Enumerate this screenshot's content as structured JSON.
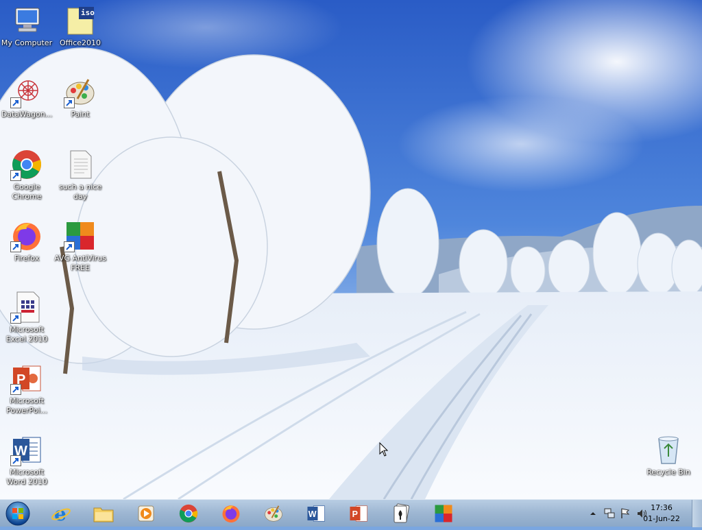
{
  "desktop": {
    "icons": [
      {
        "label": "My Computer",
        "icon": "computer-icon"
      },
      {
        "label": "Office2010",
        "icon": "iso-file-icon",
        "badge": "iso"
      },
      {
        "label": "DataWagon...",
        "icon": "datawagon-icon"
      },
      {
        "label": "Paint",
        "icon": "paint-icon"
      },
      {
        "label": "Google Chrome",
        "icon": "chrome-icon"
      },
      {
        "label": "such a nice day",
        "icon": "text-file-icon"
      },
      {
        "label": "Firefox",
        "icon": "firefox-icon"
      },
      {
        "label": "AVG AntiVirus FREE",
        "icon": "avg-icon"
      },
      {
        "label": "Microsoft Excel 2010",
        "icon": "excel-icon"
      },
      {
        "label": "Microsoft PowerPoi...",
        "icon": "powerpoint-icon"
      },
      {
        "label": "Microsoft Word 2010",
        "icon": "word-icon"
      },
      {
        "label": "Recycle Bin",
        "icon": "recycle-bin-icon"
      }
    ]
  },
  "taskbar": {
    "pinned": [
      {
        "name": "internet-explorer",
        "icon": "internet-explorer-icon"
      },
      {
        "name": "file-explorer",
        "icon": "folder-icon"
      },
      {
        "name": "media-player",
        "icon": "media-player-icon"
      },
      {
        "name": "chrome",
        "icon": "chrome-icon"
      },
      {
        "name": "firefox",
        "icon": "firefox-icon"
      },
      {
        "name": "paint",
        "icon": "paint-icon"
      },
      {
        "name": "word",
        "icon": "word-icon"
      },
      {
        "name": "powerpoint",
        "icon": "powerpoint-icon"
      },
      {
        "name": "solitaire",
        "icon": "solitaire-icon"
      },
      {
        "name": "avg",
        "icon": "avg-icon"
      }
    ],
    "clock": {
      "time": "17:36",
      "date": "01-Jun-22"
    }
  },
  "colors": {
    "sky_top": "#2f63c9",
    "sky_bottom": "#a9c8ee",
    "snow": "#f4f8fd",
    "taskbar": "#9db6d2"
  }
}
